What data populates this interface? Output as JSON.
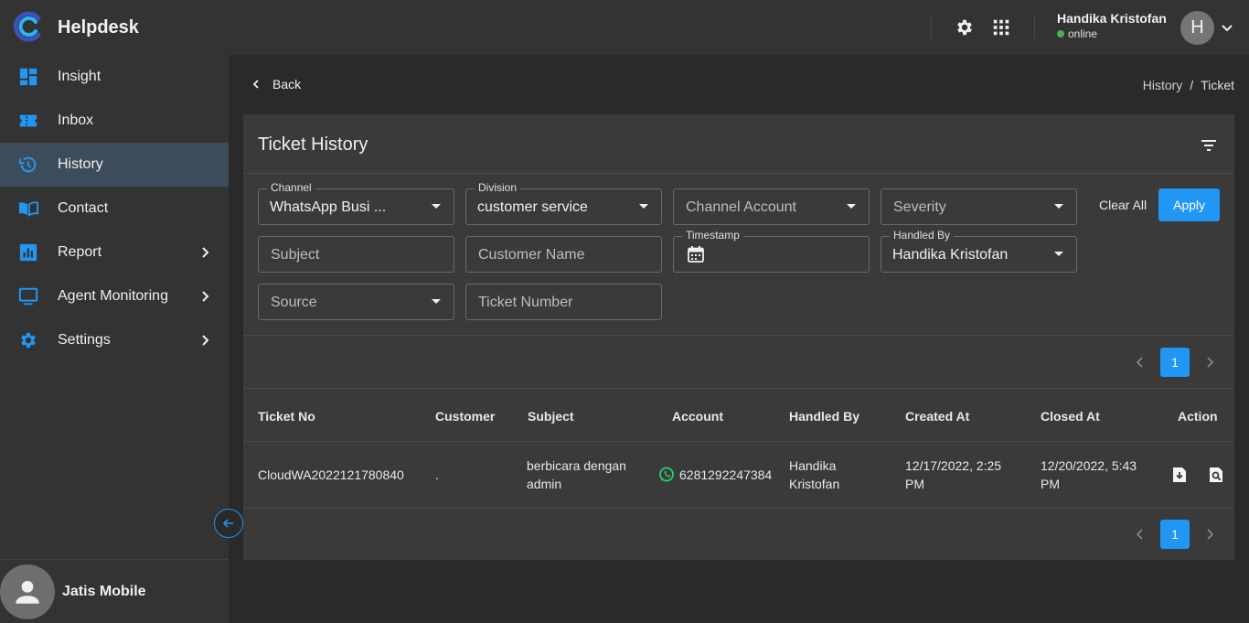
{
  "app": {
    "brand": "Helpdesk"
  },
  "user": {
    "name": "Handika Kristofan",
    "status": "online",
    "initial": "H"
  },
  "sidebar": {
    "items": [
      {
        "label": "Insight",
        "icon": "dashboard-icon"
      },
      {
        "label": "Inbox",
        "icon": "ticket-icon"
      },
      {
        "label": "History",
        "icon": "history-icon",
        "active": true
      },
      {
        "label": "Contact",
        "icon": "book-icon"
      },
      {
        "label": "Report",
        "icon": "chart-icon",
        "submenu": true
      },
      {
        "label": "Agent Monitoring",
        "icon": "monitor-icon",
        "submenu": true
      },
      {
        "label": "Settings",
        "icon": "gear-icon",
        "submenu": true
      }
    ],
    "footer_name": "Jatis Mobile"
  },
  "nav": {
    "back_label": "Back",
    "breadcrumb": [
      "History",
      "Ticket"
    ],
    "separator": "/"
  },
  "card": {
    "title": "Ticket History"
  },
  "filters": {
    "channel": {
      "label": "Channel",
      "value": "WhatsApp Busi  ..."
    },
    "division": {
      "label": "Division",
      "value": "customer service"
    },
    "channel_account": {
      "placeholder": "Channel Account"
    },
    "severity": {
      "placeholder": "Severity"
    },
    "subject": {
      "placeholder": "Subject"
    },
    "customer_name": {
      "placeholder": "Customer Name"
    },
    "timestamp": {
      "label": "Timestamp"
    },
    "handled_by": {
      "label": "Handled By",
      "value": "Handika Kristofan"
    },
    "source": {
      "placeholder": "Source"
    },
    "ticket_number": {
      "placeholder": "Ticket Number"
    },
    "clear_label": "Clear All",
    "apply_label": "Apply"
  },
  "pagination": {
    "current_page": "1"
  },
  "table": {
    "headers": [
      "Ticket No",
      "Customer",
      "Subject",
      "Account",
      "Handled By",
      "Created At",
      "Closed At",
      "Action"
    ],
    "rows": [
      {
        "ticket_no": "CloudWA2022121780840",
        "customer": ".",
        "subject": "berbicara dengan admin",
        "account": "6281292247384",
        "handled_by": "Handika Kristofan",
        "created_at": "12/17/2022, 2:25 PM",
        "closed_at": "12/20/2022, 5:43 PM"
      }
    ]
  },
  "colors": {
    "accent": "#2196f3",
    "online": "#4caf50",
    "whatsapp": "#25d366"
  }
}
